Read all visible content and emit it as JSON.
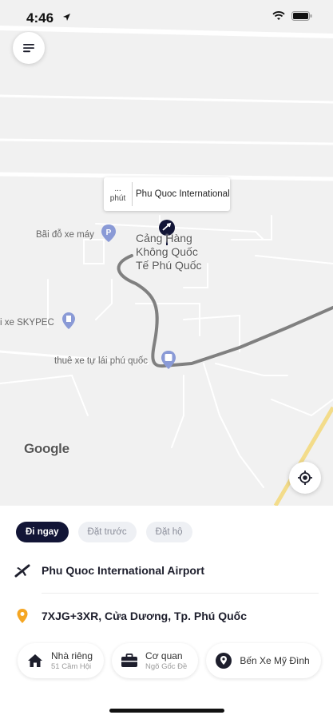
{
  "status_bar": {
    "time": "4:46"
  },
  "map": {
    "eta": {
      "value": "...",
      "unit": "phút",
      "destination": "Phu Quoc International Airp..."
    },
    "labels": {
      "parking": "Bãi đỗ xe máy",
      "airport_line1": "Cảng Hàng",
      "airport_line2": "Không Quốc",
      "airport_line3": "Tế Phú Quốc",
      "skypec": "i xe SKYPEC",
      "car_rental": "thuê xe tự lái phú quốc"
    },
    "google_logo": "Google",
    "route_color": "#808080"
  },
  "booking": {
    "tabs": [
      {
        "label": "Đi ngay",
        "active": true
      },
      {
        "label": "Đặt trước",
        "active": false
      },
      {
        "label": "Đặt hộ",
        "active": false
      }
    ],
    "pickup": {
      "text": "Phu Quoc International Airport",
      "icon": "airplane-icon"
    },
    "destination": {
      "text": "7XJG+3XR, Cửa Dương, Tp. Phú Quốc",
      "icon": "location-pin-icon"
    },
    "saved_places": [
      {
        "title": "Nhà riêng",
        "subtitle": "51 Cầm Hội",
        "icon": "home-icon"
      },
      {
        "title": "Cơ quan",
        "subtitle": "Ngõ Gốc Đề",
        "icon": "briefcase-icon"
      },
      {
        "title": "Bến Xe Mỹ Đình",
        "subtitle": "",
        "icon": "location-pin-icon"
      }
    ]
  },
  "colors": {
    "accent_dark": "#121536",
    "pin_orange": "#f5a623",
    "map_bg": "#f1f1f1"
  }
}
